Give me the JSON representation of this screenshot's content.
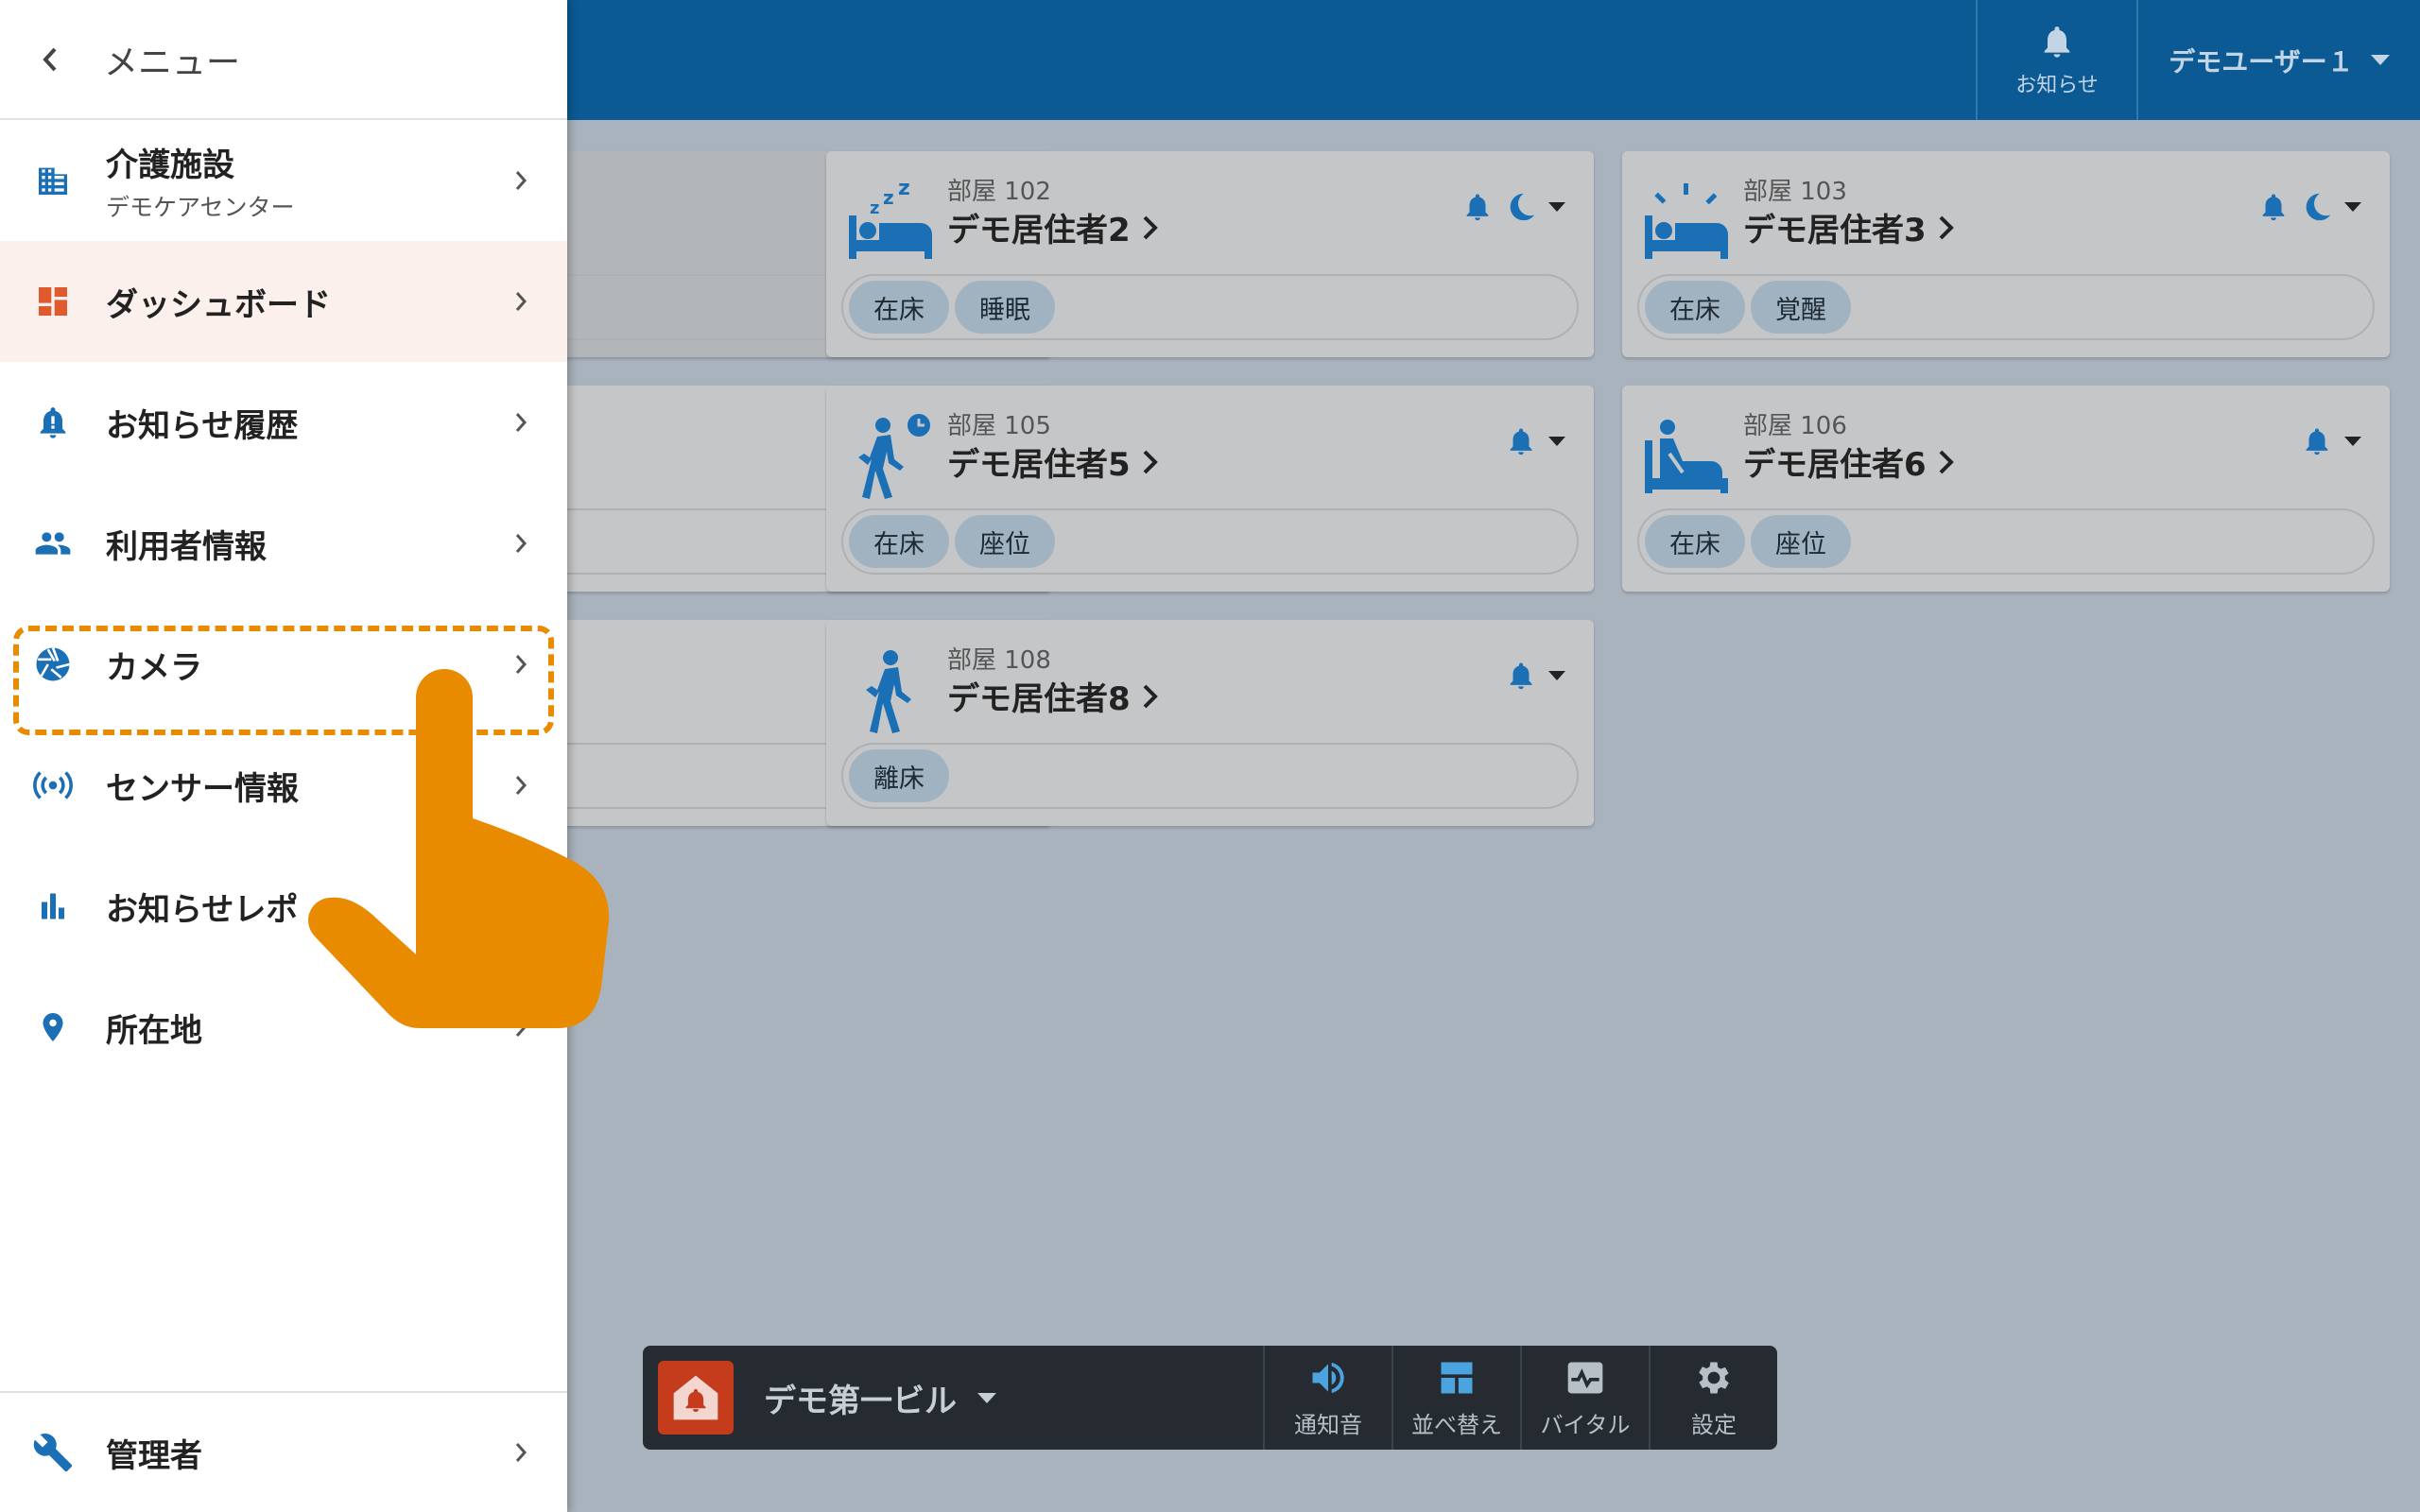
{
  "colors": {
    "topbar": "#0c5a93",
    "accent_blue": "#1a6fb5",
    "active_orange": "#e05a2f",
    "highlight": "#e88b00"
  },
  "topbar": {
    "notify_label": "お知らせ",
    "user_label": "デモユーザー１"
  },
  "drawer": {
    "title": "メニュー",
    "items": [
      {
        "label": "介護施設",
        "sub": "デモケアセンター",
        "icon": "building-icon"
      },
      {
        "label": "ダッシュボード",
        "icon": "dashboard-icon"
      },
      {
        "label": "お知らせ履歴",
        "icon": "bell-alert-icon"
      },
      {
        "label": "利用者情報",
        "icon": "people-icon"
      },
      {
        "label": "カメラ",
        "icon": "camera-aperture-icon"
      },
      {
        "label": "センサー情報",
        "icon": "sensor-icon"
      },
      {
        "label": "お知らせレポ",
        "icon": "bar-chart-icon"
      },
      {
        "label": "所在地",
        "icon": "location-pin-icon"
      }
    ],
    "bottom_item": {
      "label": "管理者",
      "icon": "wrench-icon"
    }
  },
  "cards": [
    {
      "room": "",
      "name": "",
      "tags": [],
      "icon": "dim-card"
    },
    {
      "room": "部屋 102",
      "name": "デモ居住者2",
      "tags": [
        "在床",
        "睡眠"
      ],
      "icon": "bed-sleep-icon"
    },
    {
      "room": "部屋 103",
      "name": "デモ居住者3",
      "tags": [
        "在床",
        "覚醒"
      ],
      "icon": "bed-awake-icon"
    },
    {
      "room": "",
      "name": "",
      "tags": [],
      "icon": "partial-card"
    },
    {
      "room": "部屋 105",
      "name": "デモ居住者5",
      "tags": [
        "在床",
        "座位"
      ],
      "icon": "walk-clock-icon"
    },
    {
      "room": "部屋 106",
      "name": "デモ居住者6",
      "tags": [
        "在床",
        "座位"
      ],
      "icon": "bed-sit-icon"
    },
    {
      "room": "",
      "name": "",
      "tags": [],
      "icon": "partial-card"
    },
    {
      "room": "部屋 108",
      "name": "デモ居住者8",
      "tags": [
        "離床"
      ],
      "icon": "walk-icon"
    }
  ],
  "bottombar": {
    "building": "デモ第一ビル",
    "buttons": [
      {
        "label": "通知音",
        "icon": "speaker-icon"
      },
      {
        "label": "並べ替え",
        "icon": "layout-icon"
      },
      {
        "label": "バイタル",
        "icon": "vital-icon"
      },
      {
        "label": "設定",
        "icon": "gear-icon"
      }
    ]
  }
}
